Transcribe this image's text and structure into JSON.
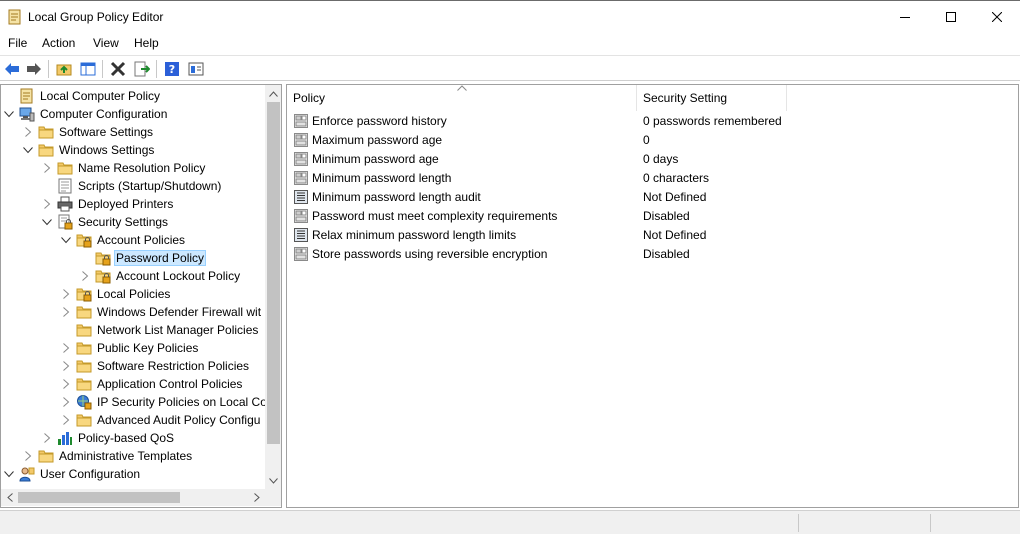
{
  "window": {
    "title": "Local Group Policy Editor",
    "icon": "policy-editor-icon",
    "controls": [
      "minimize-icon",
      "maximize-icon",
      "close-icon"
    ]
  },
  "menu": [
    "File",
    "Action",
    "View",
    "Help"
  ],
  "toolbar": [
    "back-arrow-icon",
    "forward-arrow-icon",
    "up-folder-icon",
    "show-hide-tree-icon",
    "delete-icon",
    "export-list-icon",
    "help-icon",
    "properties-icon"
  ],
  "tree": {
    "items": [
      {
        "label": "Local Computer Policy",
        "icon": "computer-policy-icon",
        "chevron": "none"
      },
      {
        "label": "Computer Configuration",
        "icon": "computer-icon",
        "chevron": "expanded"
      },
      {
        "label": "Software Settings",
        "icon": "folder-icon",
        "chevron": "collapsed"
      },
      {
        "label": "Windows Settings",
        "icon": "folder-icon",
        "chevron": "expanded"
      },
      {
        "label": "Name Resolution Policy",
        "icon": "folder-icon",
        "chevron": "collapsed"
      },
      {
        "label": "Scripts (Startup/Shutdown)",
        "icon": "scripts-icon",
        "chevron": "none"
      },
      {
        "label": "Deployed Printers",
        "icon": "printer-icon",
        "chevron": "collapsed"
      },
      {
        "label": "Security Settings",
        "icon": "security-settings-icon",
        "chevron": "expanded"
      },
      {
        "label": "Account Policies",
        "icon": "policy-folder-icon",
        "chevron": "expanded"
      },
      {
        "label": "Password Policy",
        "icon": "policy-folder-icon",
        "chevron": "none",
        "selected": true
      },
      {
        "label": "Account Lockout Policy",
        "icon": "policy-folder-icon",
        "chevron": "collapsed"
      },
      {
        "label": "Local Policies",
        "icon": "policy-folder-icon",
        "chevron": "collapsed"
      },
      {
        "label": "Windows Defender Firewall wit",
        "icon": "folder-icon",
        "chevron": "collapsed"
      },
      {
        "label": "Network List Manager Policies",
        "icon": "folder-icon",
        "chevron": "none"
      },
      {
        "label": "Public Key Policies",
        "icon": "folder-icon",
        "chevron": "collapsed"
      },
      {
        "label": "Software Restriction Policies",
        "icon": "folder-icon",
        "chevron": "collapsed"
      },
      {
        "label": "Application Control Policies",
        "icon": "folder-icon",
        "chevron": "collapsed"
      },
      {
        "label": "IP Security Policies on Local Co",
        "icon": "ip-security-icon",
        "chevron": "collapsed"
      },
      {
        "label": "Advanced Audit Policy Configu",
        "icon": "folder-icon",
        "chevron": "collapsed"
      },
      {
        "label": "Policy-based QoS",
        "icon": "qos-chart-icon",
        "chevron": "collapsed"
      },
      {
        "label": "Administrative Templates",
        "icon": "folder-icon",
        "chevron": "collapsed"
      },
      {
        "label": "User Configuration",
        "icon": "user-icon",
        "chevron": "expanded"
      }
    ]
  },
  "list": {
    "columns": [
      "Policy",
      "Security Setting"
    ],
    "rows": [
      {
        "policy": "Enforce password history",
        "setting": "0 passwords remembered",
        "icon": "policy-setting-icon"
      },
      {
        "policy": "Maximum password age",
        "setting": "0",
        "icon": "policy-setting-icon"
      },
      {
        "policy": "Minimum password age",
        "setting": "0 days",
        "icon": "policy-setting-icon"
      },
      {
        "policy": "Minimum password length",
        "setting": "0 characters",
        "icon": "policy-setting-icon"
      },
      {
        "policy": "Minimum password length audit",
        "setting": "Not Defined",
        "icon": "audit-setting-icon"
      },
      {
        "policy": "Password must meet complexity requirements",
        "setting": "Disabled",
        "icon": "policy-setting-icon"
      },
      {
        "policy": "Relax minimum password length limits",
        "setting": "Not Defined",
        "icon": "audit-setting-icon"
      },
      {
        "policy": "Store passwords using reversible encryption",
        "setting": "Disabled",
        "icon": "policy-setting-icon"
      }
    ]
  },
  "colors": {
    "selection": "#cce8ff",
    "selection_border": "#99d1ff",
    "folder": "#f3c969",
    "accent": "#2b6cd8"
  }
}
